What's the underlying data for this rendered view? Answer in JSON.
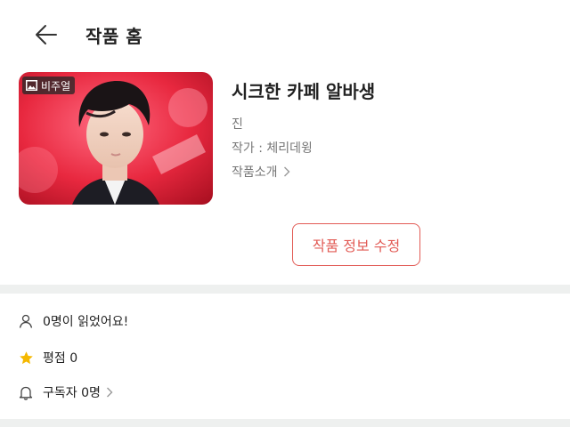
{
  "header": {
    "title": "작품 홈"
  },
  "work": {
    "badge_label": "비주얼",
    "title": "시크한 카페 알바생",
    "genre": "진",
    "author": "작가 : 체리데윙",
    "intro_label": "작품소개",
    "edit_label": "작품 정보 수정"
  },
  "stats": {
    "readers": "0명이 읽었어요!",
    "rating": "평점 0",
    "subscribers": "구독자 0명"
  },
  "icons": {
    "back": "arrow-left-icon",
    "badge": "image-icon",
    "intro_chevron": "chevron-right-icon",
    "readers": "person-icon",
    "rating": "star-icon",
    "subscribers": "bell-icon"
  },
  "colors": {
    "accent": "#e25b55",
    "star": "#f5b800",
    "divider": "#eef0ef",
    "secondary_text": "#777777"
  }
}
